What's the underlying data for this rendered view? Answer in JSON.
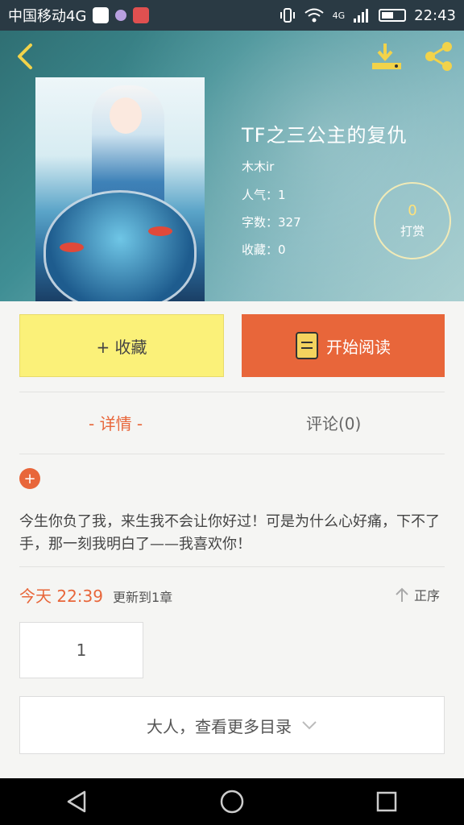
{
  "status_bar": {
    "carrier": "中国移动4G",
    "network": "4G",
    "time": "22:43"
  },
  "book": {
    "title": "TF之三公主的复仇",
    "author": "木木ir",
    "popularity": "人气：1",
    "word_count": "字数：327",
    "favorites": "收藏：0"
  },
  "tip": {
    "count": "0",
    "label": "打赏"
  },
  "actions": {
    "favorite_label": "+ 收藏",
    "read_label": "开始阅读"
  },
  "tabs": [
    {
      "label": "- 详情 -",
      "active": true
    },
    {
      "label": "评论(0)",
      "active": false
    }
  ],
  "expand_symbol": "+",
  "description": "今生你负了我，来生我不会让你好过！可是为什么心好痛，下不了手，那一刻我明白了——我喜欢你！",
  "update": {
    "time": "今天 22:39",
    "text": "更新到1章",
    "sort_label": "正序"
  },
  "chapters": [
    "1"
  ],
  "more_catalog_label": "大人，查看更多目录",
  "colors": {
    "accent": "#e8663a",
    "favorite_bg": "#fbf179",
    "tip_count": "#ffe27a"
  },
  "icons": [
    "back-arrow-icon",
    "download-icon",
    "share-icon",
    "book-icon",
    "sort-up-arrow-icon",
    "chevron-down-icon",
    "nav-back-icon",
    "nav-home-icon",
    "nav-recent-icon"
  ]
}
